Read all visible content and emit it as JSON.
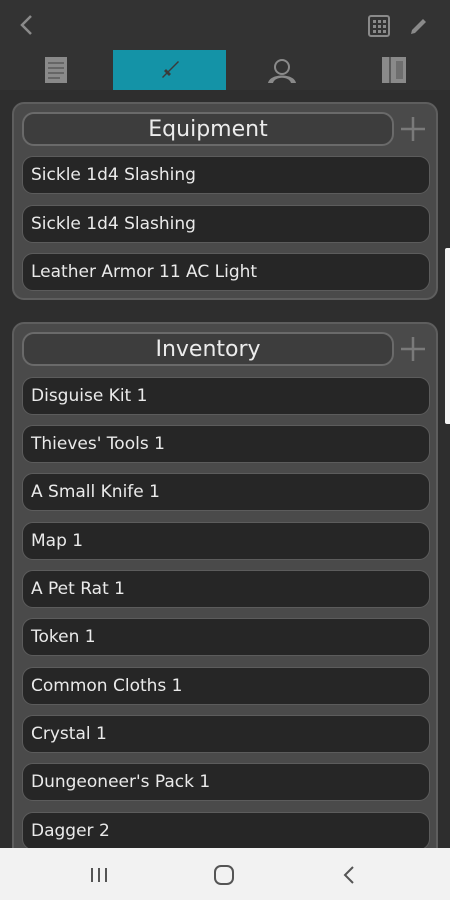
{
  "toolbar": {
    "back_icon": "chevron-left-icon",
    "grid_icon": "calculator-grid-icon",
    "edit_icon": "pencil-icon"
  },
  "tabs": [
    {
      "icon": "document-icon",
      "active": false
    },
    {
      "icon": "sword-icon",
      "active": true
    },
    {
      "icon": "person-icon",
      "active": false
    },
    {
      "icon": "book-icon",
      "active": false
    }
  ],
  "colors": {
    "accent": "#1493a7",
    "panel_bg": "#4a4a4a",
    "row_bg": "#262626",
    "background": "#2e2e2e"
  },
  "equipment": {
    "title": "Equipment",
    "items": [
      {
        "label": "Sickle 1d4 Slashing"
      },
      {
        "label": "Sickle 1d4 Slashing"
      },
      {
        "label": "Leather Armor 11 AC Light"
      }
    ]
  },
  "inventory": {
    "title": "Inventory",
    "items": [
      {
        "label": "Disguise Kit 1"
      },
      {
        "label": "Thieves' Tools 1"
      },
      {
        "label": "A Small Knife 1"
      },
      {
        "label": "Map 1"
      },
      {
        "label": "A Pet Rat 1"
      },
      {
        "label": "Token 1"
      },
      {
        "label": "Common Cloths 1"
      },
      {
        "label": "Crystal 1"
      },
      {
        "label": "Dungeoneer's Pack 1"
      },
      {
        "label": "Dagger 2"
      }
    ]
  },
  "navbar": {
    "recents_icon": "recents-icon",
    "home_icon": "home-icon",
    "back_icon": "back-icon"
  }
}
